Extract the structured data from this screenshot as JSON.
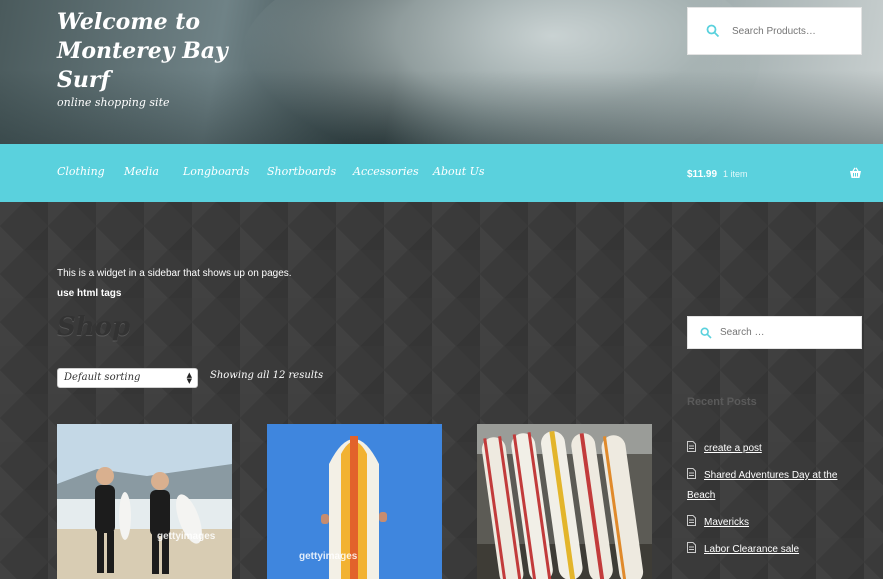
{
  "header": {
    "site_title": "Welcome to Monterey Bay Surf",
    "tagline": "online shopping site",
    "search_placeholder": "Search Products…"
  },
  "nav": {
    "items": [
      {
        "label": "Clothing"
      },
      {
        "label": "Media"
      },
      {
        "label": "Longboards"
      },
      {
        "label": "Shortboards"
      },
      {
        "label": "Accessories"
      },
      {
        "label": "About Us"
      }
    ]
  },
  "cart": {
    "amount": "$11.99",
    "count": "1 item",
    "icon": "basket-icon"
  },
  "widget": {
    "text": "This is a widget in a sidebar that shows up on pages.",
    "bold_text": "use html tags"
  },
  "shop": {
    "title": "Shop",
    "sort_selected": "Default sorting",
    "result_count": "Showing all 12 results",
    "products": [
      {
        "image": "two surfers in wetsuits on beach",
        "watermark": "gettyimages"
      },
      {
        "image": "yellow surfboard against blue sky",
        "watermark": "gettyimages"
      },
      {
        "image": "row of longboards against wall",
        "watermark": ""
      }
    ]
  },
  "sidebar": {
    "search_placeholder": "Search …",
    "recent_heading": "Recent Posts",
    "posts": [
      {
        "label": "create a post"
      },
      {
        "label": "Shared Adventures Day at the Beach"
      },
      {
        "label": "Mavericks"
      },
      {
        "label": "Labor Clearance sale"
      }
    ]
  },
  "colors": {
    "nav_bg": "#5ad1dd",
    "content_bg": "#3a3a3a"
  }
}
